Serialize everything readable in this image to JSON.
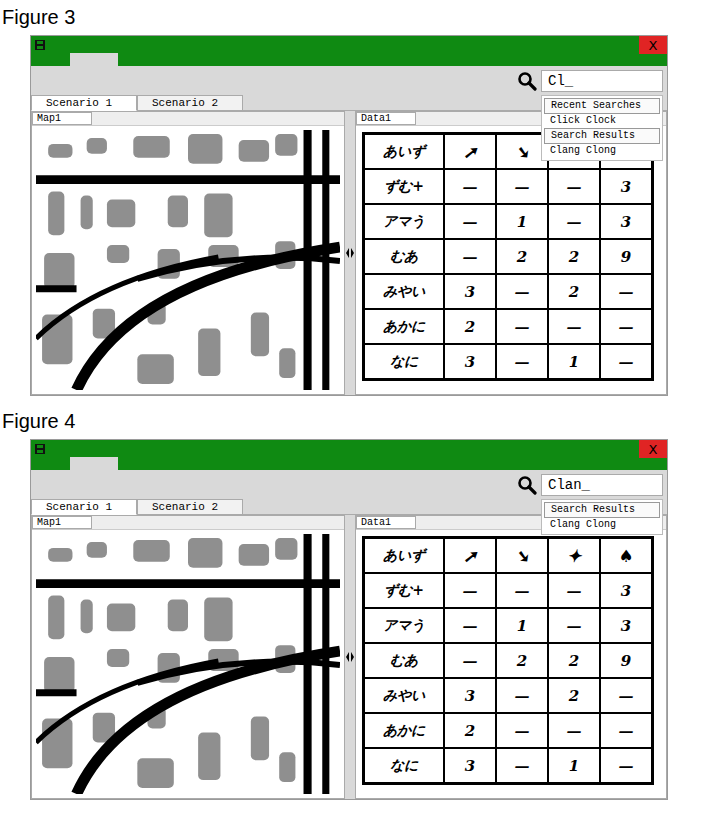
{
  "figures": [
    {
      "caption": "Figure 3",
      "window": {
        "close": "X"
      },
      "search": {
        "value": "Cl_"
      },
      "suggestions": [
        {
          "label": "Recent Searches",
          "kind": "header"
        },
        {
          "label": "Click Clock",
          "kind": "item"
        },
        {
          "label": "Search Results",
          "kind": "header"
        },
        {
          "label": "Clang Clong",
          "kind": "item"
        }
      ],
      "tabs": [
        {
          "label": "Scenario 1",
          "selected": true
        },
        {
          "label": "Scenario 2",
          "selected": false
        }
      ],
      "map": {
        "title": "Map1"
      },
      "data": {
        "title": "Data1",
        "columns": [
          "あいず",
          "➚",
          "➘",
          "✦",
          "♠"
        ],
        "rows": [
          [
            "ずむ+",
            "—",
            "—",
            "—",
            "3"
          ],
          [
            "アマう",
            "—",
            "1",
            "—",
            "3"
          ],
          [
            "むあ",
            "—",
            "2",
            "2",
            "9"
          ],
          [
            "みやい",
            "3",
            "—",
            "2",
            "—"
          ],
          [
            "あかに",
            "2",
            "—",
            "—",
            "—"
          ],
          [
            "なに",
            "3",
            "—",
            "1",
            "—"
          ]
        ]
      }
    },
    {
      "caption": "Figure 4",
      "window": {
        "close": "X"
      },
      "search": {
        "value": "Clan_"
      },
      "suggestions": [
        {
          "label": "Search Results",
          "kind": "header"
        },
        {
          "label": "Clang Clong",
          "kind": "item"
        }
      ],
      "tabs": [
        {
          "label": "Scenario 1",
          "selected": true
        },
        {
          "label": "Scenario 2",
          "selected": false
        }
      ],
      "map": {
        "title": "Map1"
      },
      "data": {
        "title": "Data1",
        "columns": [
          "あいず",
          "➚",
          "➘",
          "✦",
          "♠"
        ],
        "rows": [
          [
            "ずむ+",
            "—",
            "—",
            "—",
            "3"
          ],
          [
            "アマう",
            "—",
            "1",
            "—",
            "3"
          ],
          [
            "むあ",
            "—",
            "2",
            "2",
            "9"
          ],
          [
            "みやい",
            "3",
            "—",
            "2",
            "—"
          ],
          [
            "あかに",
            "2",
            "—",
            "—",
            "—"
          ],
          [
            "なに",
            "3",
            "—",
            "1",
            "—"
          ]
        ]
      }
    }
  ]
}
